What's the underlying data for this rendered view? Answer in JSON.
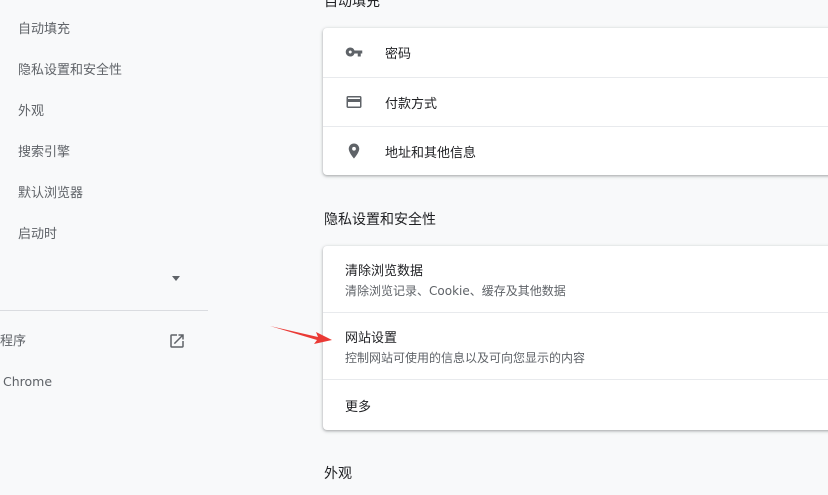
{
  "sidebar": {
    "items": [
      {
        "label": "自动填充"
      },
      {
        "label": "隐私设置和安全性"
      },
      {
        "label": "外观"
      },
      {
        "label": "搜索引擎"
      },
      {
        "label": "默认浏览器"
      },
      {
        "label": "启动时"
      }
    ],
    "extensions_label": "程序",
    "about_label": "Chrome"
  },
  "main": {
    "autofill_title": "自动填充",
    "autofill_items": [
      {
        "label": "密码",
        "icon": "key-icon"
      },
      {
        "label": "付款方式",
        "icon": "credit-card-icon"
      },
      {
        "label": "地址和其他信息",
        "icon": "location-pin-icon"
      }
    ],
    "privacy_title": "隐私设置和安全性",
    "privacy_items": [
      {
        "title": "清除浏览数据",
        "subtitle": "清除浏览记录、Cookie、缓存及其他数据"
      },
      {
        "title": "网站设置",
        "subtitle": "控制网站可使用的信息以及可向您显示的内容"
      },
      {
        "title": "更多"
      }
    ],
    "appearance_title": "外观"
  },
  "colors": {
    "annotation_arrow": "#ea3a35",
    "icon": "#5f6368"
  }
}
